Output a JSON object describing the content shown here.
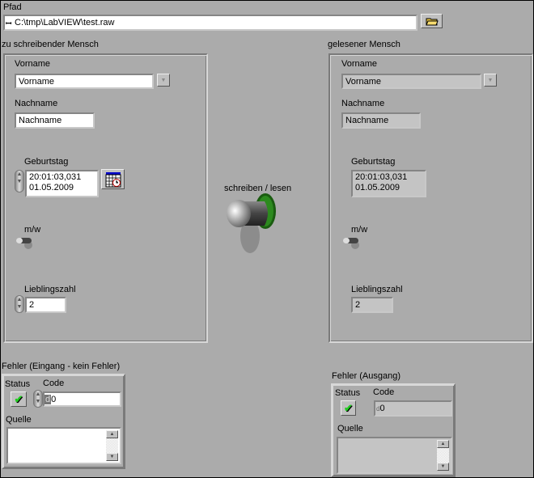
{
  "path": {
    "label": "Pfad",
    "value": "C:\\tmp\\LabVIEW\\test.raw"
  },
  "writer": {
    "title": "zu schreibender Mensch",
    "vorname_label": "Vorname",
    "vorname": "Vorname",
    "nachname_label": "Nachname",
    "nachname": "Nachname",
    "geburtstag_label": "Geburtstag",
    "time": "20:01:03,031",
    "date": "01.05.2009",
    "mw_label": "m/w",
    "lieblingszahl_label": "Lieblingszahl",
    "lieblingszahl": "2"
  },
  "reader": {
    "title": "gelesener Mensch",
    "vorname_label": "Vorname",
    "vorname": "Vorname",
    "nachname_label": "Nachname",
    "nachname": "Nachname",
    "geburtstag_label": "Geburtstag",
    "time": "20:01:03,031",
    "date": "01.05.2009",
    "mw_label": "m/w",
    "lieblingszahl_label": "Lieblingszahl",
    "lieblingszahl": "2"
  },
  "switch": {
    "label": "schreiben / lesen"
  },
  "error_in": {
    "title": "Fehler (Eingang - kein Fehler)",
    "status_label": "Status",
    "code_label": "Code",
    "code_prefix": "d",
    "code": "0",
    "source_label": "Quelle",
    "source": ""
  },
  "error_out": {
    "title": "Fehler (Ausgang)",
    "status_label": "Status",
    "code_label": "Code",
    "code_prefix": "d",
    "code": "0",
    "source_label": "Quelle",
    "source": ""
  },
  "colors": {
    "panel": "#ababab",
    "check": "#22cc22"
  }
}
